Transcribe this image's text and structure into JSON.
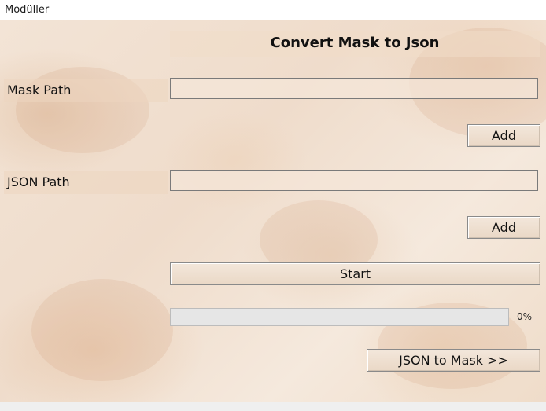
{
  "menu": {
    "label": "Modüller"
  },
  "header": {
    "title": "Convert Mask to Json"
  },
  "mask": {
    "label": "Mask Path",
    "value": "",
    "add_label": "Add"
  },
  "json": {
    "label": "JSON Path",
    "value": "",
    "add_label": "Add"
  },
  "actions": {
    "start_label": "Start",
    "switch_label": "JSON to Mask >>"
  },
  "progress": {
    "value": 0,
    "text": "0%"
  },
  "colors": {
    "progress_fill": "#06b025",
    "background": "#f3e4d6"
  }
}
